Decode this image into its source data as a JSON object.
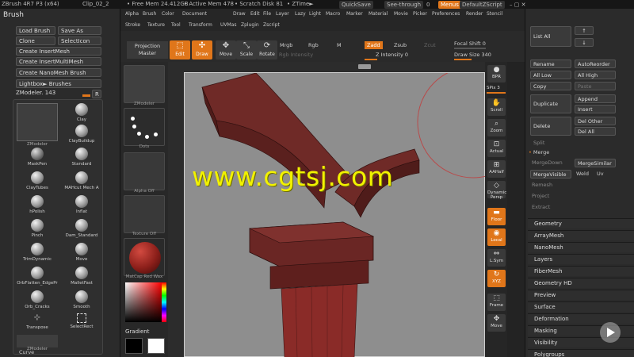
{
  "topbar": {
    "app": "ZBrush 4R7 P3 (x64)",
    "file": "Clip_02_2",
    "free_mem": "• Free Mem 24.412GB",
    "active_mem": "• Active Mem 478",
    "scratch": "• Scratch Disk 81",
    "ztime": "• ZTime►",
    "quicksave": "QuickSave",
    "seethrough": "See-through",
    "seethrough_val": "0",
    "menus": "Menus",
    "script": "DefaultZScript",
    "win_controls": "– ▢ ✕"
  },
  "menus": [
    "Alpha",
    "Brush",
    "Color",
    "Document",
    "Draw",
    "Edit",
    "File",
    "Layer",
    "Lazy",
    "Light",
    "Macro",
    "Marker",
    "Material",
    "Movie",
    "Picker",
    "Preferences",
    "Render",
    "Stencil"
  ],
  "menus2": [
    "Stroke",
    "Texture",
    "Tool",
    "Transform",
    "UVMas",
    "Zplugin",
    "Zscript"
  ],
  "brush_palette": {
    "title": "Brush",
    "load": "Load Brush",
    "save_as": "Save As",
    "clone": "Clone",
    "select_icon": "SelectIcon",
    "insert_mesh": "Create InsertMesh",
    "insert_multi": "Create InsertMultiMesh",
    "nanomesh": "Create NanoMesh Brush",
    "lightbox": "Lightbox► Brushes",
    "current": "ZModeler. 143",
    "r": "R",
    "current_lbl": "ZModeler",
    "brushes": [
      "Clay",
      "ClayBuildup",
      "MaskPen",
      "Standard",
      "ClayTubes",
      "MAHcut Mech A",
      "hPolish",
      "Inflat",
      "Pinch",
      "Dam_Standard",
      "TrimDynamic",
      "Move",
      "OrbFlatten_EdgePr",
      "MalletFast",
      "Orb_Cracks",
      "Smooth",
      "Transpose",
      "SelectRect"
    ],
    "bottom_lbl": "ZModeler",
    "curve": "Curve"
  },
  "material_col": {
    "thumb1": "ZModeler",
    "thumb2": "Dots",
    "thumb3": "Alpha Off",
    "thumb4": "Texture Off",
    "thumb5": "MatCap Red Wax",
    "gradient": "Gradient"
  },
  "toolbar": {
    "projection": "Projection Master",
    "edit": "Edit",
    "draw": "Draw",
    "move": "Move",
    "scale": "Scale",
    "rotate": "Rotate",
    "mrgb": "Mrgb",
    "rgb": "Rgb",
    "m": "M",
    "rgb_intensity": "Rgb Intensity",
    "zadd": "Zadd",
    "zsub": "Zsub",
    "zcut": "Zcut",
    "z_intensity": "Z Intensity 0",
    "focal": "Focal Shift 0",
    "draw_size": "Draw Size 340"
  },
  "right_shelf": [
    "BPR",
    "SPix 3",
    "Scroll",
    "Zoom",
    "Actual",
    "AAHalf",
    "Dynamic Persp",
    "Floor",
    "Local",
    "L.Sym",
    "XYZ",
    "Frame",
    "Move"
  ],
  "right_palette": {
    "list_all": "List All",
    "rename": "Rename",
    "autoreorder": "AutoReorder",
    "all_low": "All Low",
    "all_high": "All High",
    "copy": "Copy",
    "paste": "Paste",
    "duplicate": "Duplicate",
    "append": "Append",
    "insert": "Insert",
    "delete": "Delete",
    "del_other": "Del Other",
    "del_all": "Del All",
    "split": "Split",
    "merge": "Merge",
    "mergedown": "MergeDown",
    "mergesimilar": "MergeSimilar",
    "mergevisible": "MergeVisible",
    "weld": "Weld",
    "uv": "Uv",
    "remesh": "Remesh",
    "project": "Project",
    "extract": "Extract",
    "subpalettes": [
      "Geometry",
      "ArrayMesh",
      "NanoMesh",
      "Layers",
      "FiberMesh",
      "Geometry HD",
      "Preview",
      "Surface",
      "Deformation",
      "Masking",
      "Visibility",
      "Polygroups"
    ]
  },
  "watermark": "www.cgtsj.com",
  "colors": {
    "accent": "#e0761a",
    "model": "#7a2f2c",
    "canvas": "#8e8e8e"
  }
}
